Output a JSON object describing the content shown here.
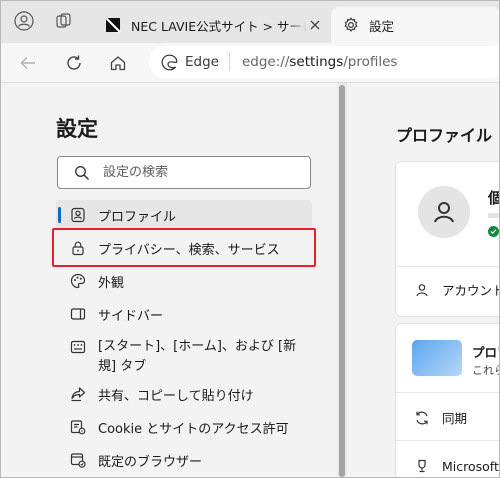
{
  "browser": {
    "tabs": [
      {
        "title": "NEC LAVIE公式サイト > サービス＆サポート",
        "active": false
      },
      {
        "title": "設定",
        "active": true
      }
    ],
    "address": {
      "site_label": "Edge",
      "url_scheme": "edge://",
      "url_host": "settings",
      "url_path": "/profiles"
    }
  },
  "sidebar": {
    "title": "設定",
    "search_placeholder": "設定の検索",
    "items": [
      {
        "label": "プロファイル",
        "icon": "profile-icon",
        "active": true
      },
      {
        "label": "プライバシー、検索、サービス",
        "icon": "lock-icon",
        "highlighted": true
      },
      {
        "label": "外観",
        "icon": "palette-icon"
      },
      {
        "label": "サイドバー",
        "icon": "sidebar-icon"
      },
      {
        "label": "[スタート]、[ホーム]、および [新規] タブ",
        "icon": "home-tab-icon"
      },
      {
        "label": "共有、コピーして貼り付け",
        "icon": "share-icon"
      },
      {
        "label": "Cookie とサイトのアクセス許可",
        "icon": "cookie-permission-icon"
      },
      {
        "label": "既定のブラウザー",
        "icon": "default-browser-icon"
      }
    ]
  },
  "content": {
    "title": "プロファイル",
    "profile_name": "個",
    "account_row": "アカウント",
    "promo_title": "プロフ",
    "promo_sub": "これら",
    "sync_row": "同期",
    "microsoft_row": "Microsoft"
  },
  "colors": {
    "accent": "#0f6cbd",
    "highlight_box": "#e8202a",
    "sync_ok": "#10893e"
  }
}
